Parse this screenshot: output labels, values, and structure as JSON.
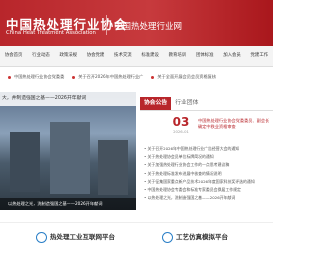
{
  "header": {
    "logo_cn": "中国热处理行业协会",
    "logo_en": "China Heat Treatment Association",
    "slogan": "中国热处理行业网"
  },
  "nav": [
    "协会首页",
    "行业动态",
    "政策法规",
    "协会党建",
    "技术交流",
    "标准建设",
    "教育培训",
    "团体标准",
    "加入会员",
    "党建工作"
  ],
  "ticker": [
    "中国热处理行业协会党委委",
    "关于召开2026年中国热处理行业广",
    "关于全面开展会员会员资格复核"
  ],
  "banner": {
    "caption_top": "大，井制造强国之基——2026开年献词",
    "caption_bottom": "以热处理之光，洗制造强国之基——2026开年献词"
  },
  "tabs": [
    {
      "label": "协会公告",
      "active": true
    },
    {
      "label": "行业团体",
      "active": false
    }
  ],
  "featured": {
    "day": "03",
    "ym": "2026-01",
    "title": "中国热处理行业协会党委委员、副会长确定中秩业资格审查"
  },
  "list": [
    "关于召开2026年中国热处理行业广告经营大会的通知",
    "关于热处理协会员单位标牌简况的通知",
    "关于加强热处理行业协会工作的一点思考建议稿",
    "关于热处理标准发布进展中核查的情况说明",
    "关于征集国家重点新产品技术2026年度国家科技奖评选的通知",
    "中国热处理协会专委会和标准专家委员会换届工作规定",
    "以热处理之光，洗制造强国之基——2026开年献词"
  ],
  "bottom": {
    "left": "热处理工业互联网平台",
    "right": "工艺仿真模拟平台"
  }
}
